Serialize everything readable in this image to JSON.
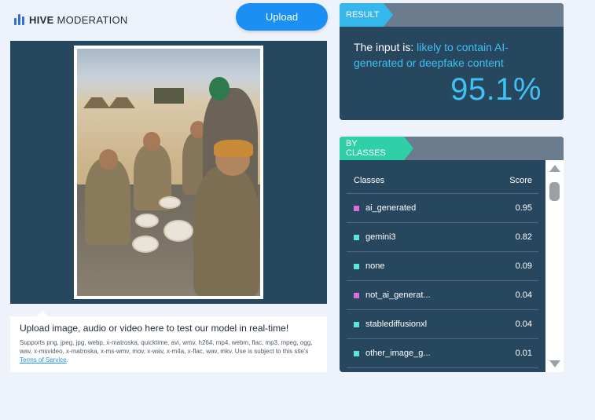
{
  "logo": {
    "brand": "HIVE",
    "product": "MODERATION"
  },
  "upload_button": "Upload",
  "caption": {
    "title": "Upload image, audio or video here to test our model in real-time!",
    "supports": "Supports png, jpeg, jpg, webp, x-matroska, quicktime, avi, wmv, h264, mp4, webm, flac, mp3, mpeg, ogg, wav, x-msvideo, x-matroska, x-ms-wmv, mov, x-wav, x-m4a, x-flac, wav, mkv. Use is subject to this site's ",
    "terms_link": "Terms of Service",
    "terms_suffix": "."
  },
  "result": {
    "tag": "RESULT",
    "prefix": "The input is: ",
    "verdict": "likely to contain AI-generated or deepfake content",
    "score": "95.1%",
    "accent": "#3ec1f4"
  },
  "classes": {
    "tag": "BY CLASSES",
    "header_class": "Classes",
    "header_score": "Score",
    "rows": [
      {
        "name": "ai_generated",
        "score": "0.95",
        "color": "#d86de0"
      },
      {
        "name": "gemini3",
        "score": "0.82",
        "color": "#5ee3e0"
      },
      {
        "name": "none",
        "score": "0.09",
        "color": "#5ee3e0"
      },
      {
        "name": "not_ai_generat...",
        "score": "0.04",
        "color": "#d86de0"
      },
      {
        "name": "stablediffusionxl",
        "score": "0.04",
        "color": "#5ee3e0"
      },
      {
        "name": "other_image_g...",
        "score": "0.01",
        "color": "#5ee3e0"
      }
    ]
  }
}
